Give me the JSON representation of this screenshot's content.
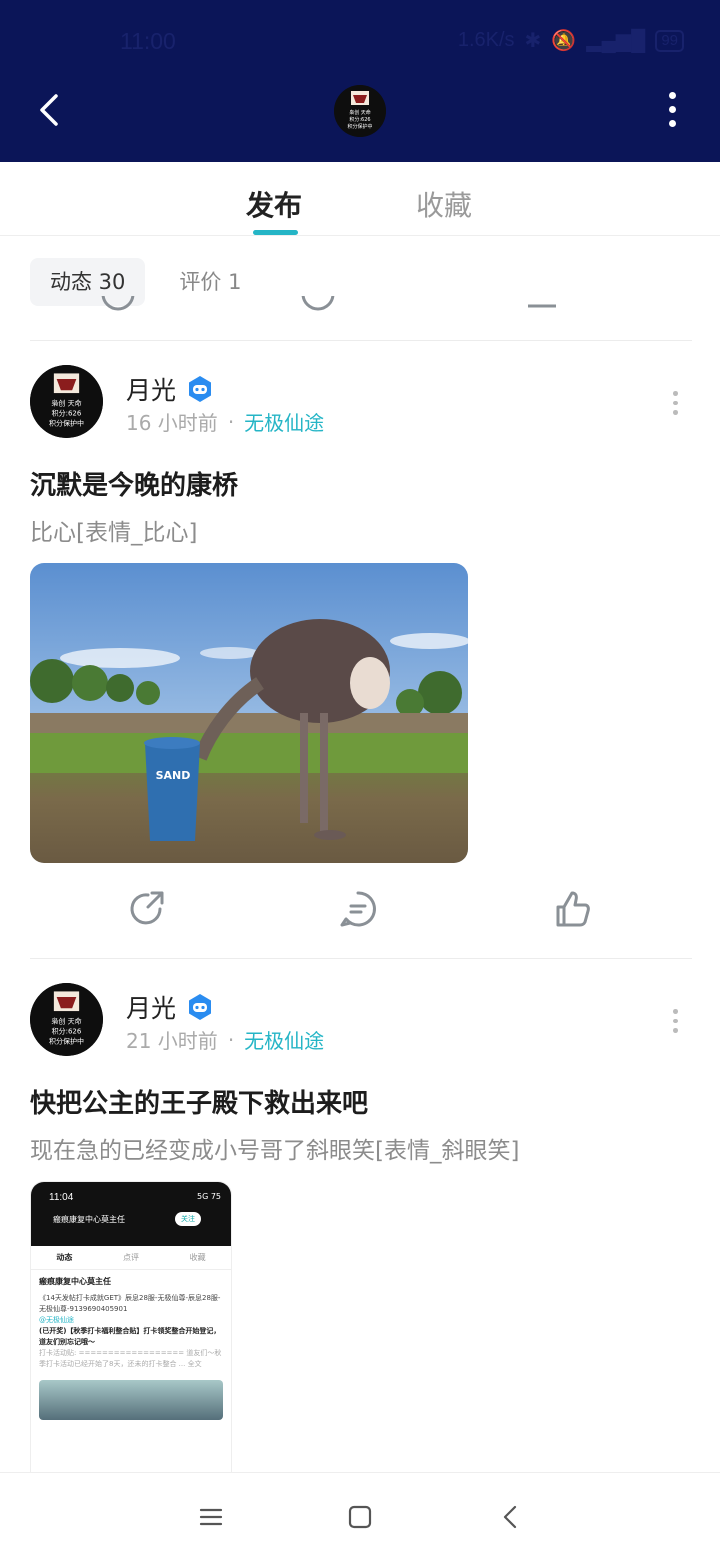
{
  "status_bar": {
    "time": "11:00",
    "net_speed": "1.6K/s",
    "battery": "99"
  },
  "header_avatar": {
    "lines": [
      "枭创 · 天命",
      "积分: 626",
      "积分保护中"
    ]
  },
  "tabs": [
    {
      "label": "发布",
      "active": true
    },
    {
      "label": "收藏",
      "active": false
    }
  ],
  "filters": [
    {
      "label": "动态 30",
      "active": true
    },
    {
      "label": "评价 1",
      "active": false
    }
  ],
  "posts": [
    {
      "author": "月光",
      "time": "16 小时前",
      "separator": "·",
      "game": "无极仙途",
      "title": "沉默是今晚的康桥",
      "text": "比心[表情_比心]",
      "image_label": "SAND"
    },
    {
      "author": "月光",
      "time": "21 小时前",
      "separator": "·",
      "game": "无极仙途",
      "title": "快把公主的王子殿下救出来吧",
      "text": "现在急的已经变成小号哥了斜眼笑[表情_斜眼笑]",
      "screenshot": {
        "time": "11:04",
        "signal": "5G 75",
        "title": "瘢痕康复中心莫主任",
        "follow": "关注",
        "tabs": [
          "动态",
          "点评",
          "收藏"
        ],
        "card_author": "瘢痕康复中心莫主任",
        "card_line1": "《14天发帖打卡成就GET》辰息28服-无极仙尊-辰息28服-无极仙尊-9139690405901",
        "card_game": "@无极仙途",
        "card_line2": "(已开奖)【秋季打卡福利整合贴】打卡领奖整合开始登记，道友们别忘记哦～",
        "card_line3": "打卡活动贴: ================== 道友们～秋季打卡活动已经开始了8天，还未的打卡整合 ... 全文"
      }
    }
  ],
  "colors": {
    "header_bg": "#0b1558",
    "accent": "#25b5c6"
  },
  "icons": [
    "back-icon",
    "more-vertical-icon",
    "share-icon",
    "comment-icon",
    "like-icon",
    "verified-badge-icon",
    "menu-icon",
    "home-icon",
    "nav-back-icon"
  ]
}
